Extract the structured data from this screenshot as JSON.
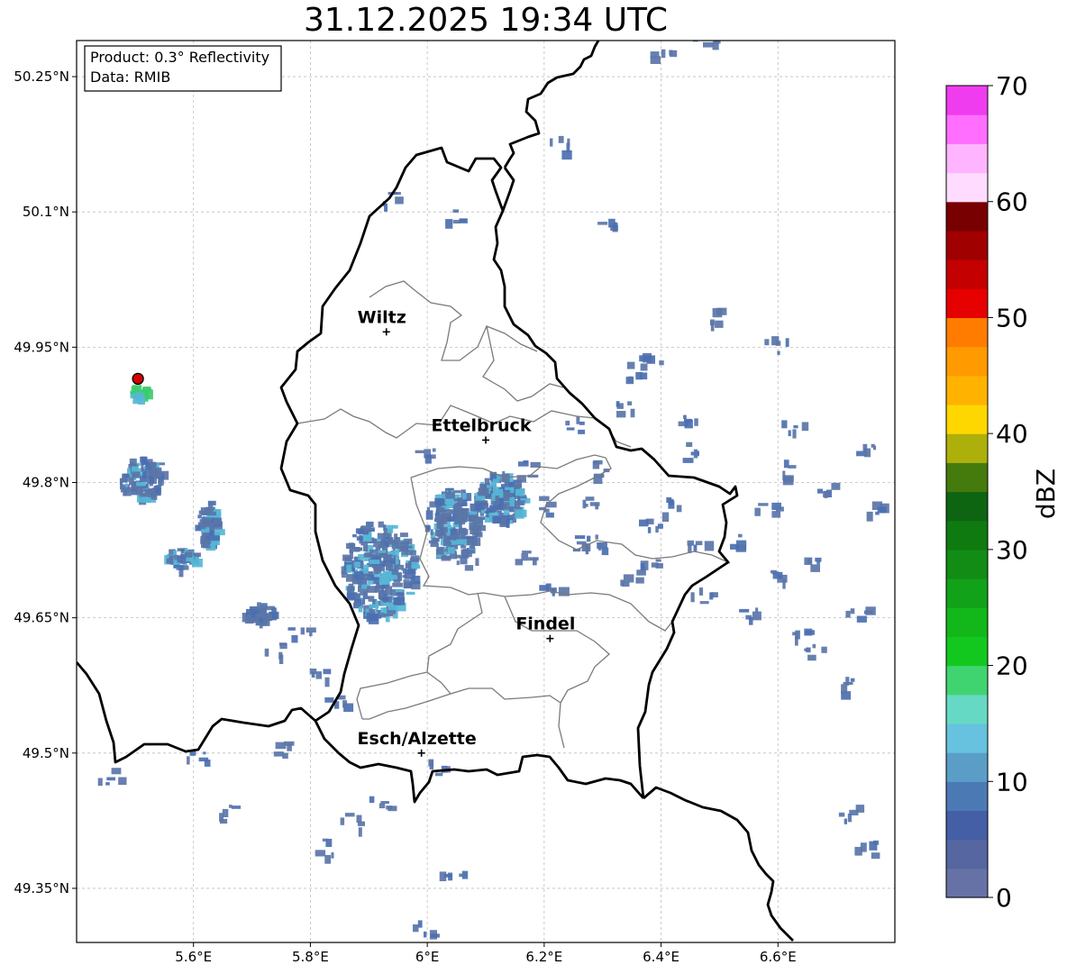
{
  "title": "31.12.2025 19:34 UTC",
  "info": {
    "product": "Product: 0.3° Reflectivity",
    "data": "Data: RMIB"
  },
  "map": {
    "lon_range": [
      5.4,
      6.8
    ],
    "lat_range": [
      49.29,
      50.29
    ],
    "lat_ticks": [
      {
        "value": 50.25,
        "label": "50.25°N"
      },
      {
        "value": 50.1,
        "label": "50.1°N"
      },
      {
        "value": 49.95,
        "label": "49.95°N"
      },
      {
        "value": 49.8,
        "label": "49.8°N"
      },
      {
        "value": 49.65,
        "label": "49.65°N"
      },
      {
        "value": 49.5,
        "label": "49.5°N"
      },
      {
        "value": 49.35,
        "label": "49.35°N"
      }
    ],
    "lon_ticks": [
      {
        "value": 5.6,
        "label": "5.6°E"
      },
      {
        "value": 5.8,
        "label": "5.8°E"
      },
      {
        "value": 6.0,
        "label": "6°E"
      },
      {
        "value": 6.2,
        "label": "6.2°E"
      },
      {
        "value": 6.4,
        "label": "6.4°E"
      },
      {
        "value": 6.6,
        "label": "6.6°E"
      }
    ],
    "grid": true,
    "cities": [
      {
        "name": "Wiltz",
        "lon": 5.93,
        "lat": 49.967
      },
      {
        "name": "Ettelbruck",
        "lon": 6.1,
        "lat": 49.847
      },
      {
        "name": "Findel",
        "lon": 6.21,
        "lat": 49.627
      },
      {
        "name": "Esch/Alzette",
        "lon": 5.99,
        "lat": 49.5
      }
    ],
    "radar_site": {
      "lon": 5.505,
      "lat": 49.915,
      "color": "#d40000"
    }
  },
  "colorbar": {
    "label": "dBZ",
    "min": 0,
    "max": 70,
    "step": 2.5,
    "ticks": [
      0,
      10,
      20,
      30,
      40,
      50,
      60,
      70
    ],
    "colors": [
      "#6672a6",
      "#5566a0",
      "#445fa5",
      "#4b79b4",
      "#5a9ec8",
      "#66c2de",
      "#66d9c4",
      "#40d470",
      "#12c81e",
      "#12b81a",
      "#12a21a",
      "#128c14",
      "#0f7a10",
      "#0d6411",
      "#457a0c",
      "#adb00a",
      "#ffd700",
      "#ffb300",
      "#ff9a00",
      "#ff7c00",
      "#e60000",
      "#c40000",
      "#a00000",
      "#780000",
      "#ffdcff",
      "#ffb4ff",
      "#ff6eff",
      "#ee3cee"
    ]
  },
  "echo_colors": {
    "weak": "#5a75a8",
    "light": "#4b6fb0",
    "moderate": "#56b6d6",
    "green": "#3ccc6c"
  }
}
